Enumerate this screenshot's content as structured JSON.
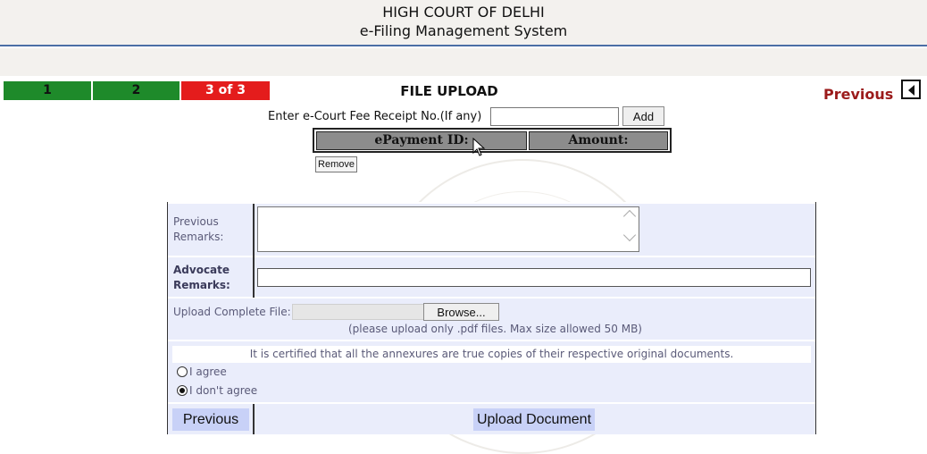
{
  "header": {
    "title": "HIGH COURT OF DELHI",
    "subtitle": "e-Filing Management System"
  },
  "steps": {
    "items": [
      {
        "label": "1",
        "state": "done",
        "color": "#1e8a2a"
      },
      {
        "label": "2",
        "state": "done",
        "color": "#1e8a2a"
      },
      {
        "label": "3 of 3",
        "state": "current",
        "color": "#e41c1c"
      }
    ],
    "page_title": "FILE UPLOAD",
    "previous_label": "Previous"
  },
  "fee": {
    "label": "Enter e-Court Fee Receipt No.(If any)",
    "value": "",
    "add_label": "Add"
  },
  "payments": {
    "headers": [
      "ePayment ID:",
      "Amount:"
    ],
    "remove_label": "Remove"
  },
  "form": {
    "previous_remarks_label": "Previous Remarks:",
    "previous_remarks_value": "",
    "advocate_remarks_label": "Advocate Remarks:",
    "advocate_remarks_value": "",
    "upload_label": "Upload Complete File:",
    "browse_label": "Browse...",
    "upload_hint": "(please upload only .pdf files. Max size allowed 50 MB)",
    "certification": "It is certified that all the annexures are true copies of their respective original documents.",
    "agree_label": "I agree",
    "disagree_label": "I don't agree",
    "selected_option": "I don't agree",
    "previous_button": "Previous",
    "upload_button": "Upload Document"
  },
  "colors": {
    "accent": "#4b6ea5",
    "form_bg": "#eaedfb",
    "button_bg": "#c8d1f7",
    "previous_link": "#9b1b1b"
  }
}
